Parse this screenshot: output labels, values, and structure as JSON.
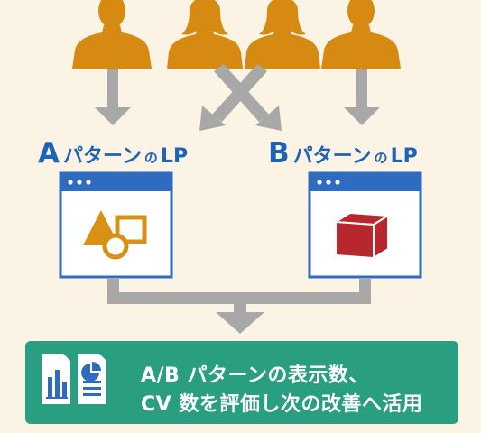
{
  "colors": {
    "background": "#fbf3e4",
    "person": "#d68a12",
    "arrow": "#a8a8a8",
    "window_frame": "#2f6cbf",
    "shapes_a": "#d89114",
    "cube_b": "#b8272d",
    "result_box": "#2a9e80"
  },
  "people": [
    {
      "icon": "male-user-icon"
    },
    {
      "icon": "female-user-icon"
    },
    {
      "icon": "female-user-icon"
    },
    {
      "icon": "male-user-icon"
    }
  ],
  "lp_a": {
    "letter": "A",
    "label": "パターン",
    "particle": "の",
    "suffix": "LP",
    "icon": "shapes-icon"
  },
  "lp_b": {
    "letter": "B",
    "label": "パターン",
    "particle": "の",
    "suffix": "LP",
    "icon": "cube-icon"
  },
  "result": {
    "icons": [
      "bar-chart-report-icon",
      "pie-chart-document-icon"
    ],
    "line1": "A/B パターンの表示数、",
    "line2": "CV 数を評価し次の改善へ活用"
  }
}
